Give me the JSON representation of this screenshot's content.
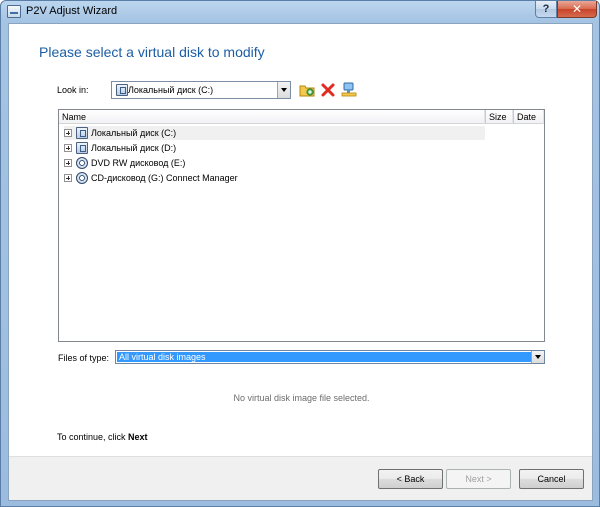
{
  "window": {
    "title": "P2V Adjust Wizard"
  },
  "titlebar": {
    "help_glyph": "?",
    "close_glyph": "✕"
  },
  "page": {
    "title": "Please select a virtual disk to modify"
  },
  "look_in": {
    "label": "Look in:",
    "value": "Локальный диск (C:)"
  },
  "toolbar": {
    "icons": [
      "new-folder-icon",
      "delete-icon",
      "network-drive-icon"
    ]
  },
  "file_list": {
    "columns": [
      "Name",
      "Size",
      "Date"
    ],
    "rows": [
      {
        "label": "Локальный диск (C:)",
        "icon": "drive-icon"
      },
      {
        "label": "Локальный диск (D:)",
        "icon": "drive-icon"
      },
      {
        "label": "DVD RW дисковод (E:)",
        "icon": "disc-icon"
      },
      {
        "label": "CD-дисковод (G:) Connect Manager",
        "icon": "disc-icon"
      }
    ]
  },
  "files_of_type": {
    "label": "Files of type:",
    "value": "All virtual disk images"
  },
  "status": {
    "text": "No virtual disk image file selected."
  },
  "continue": {
    "prefix": "To continue, click ",
    "action": "Next"
  },
  "buttons": {
    "back": "< Back",
    "next": "Next >",
    "cancel": "Cancel"
  },
  "colors": {
    "accent": "#1c5ea6",
    "selection": "#3399ff"
  }
}
